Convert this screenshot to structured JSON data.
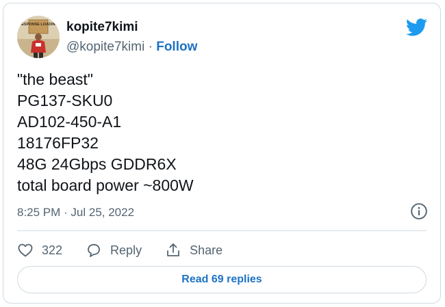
{
  "author": {
    "display_name": "kopite7kimi",
    "handle": "@kopite7kimi",
    "separator": "·",
    "follow_label": "Follow",
    "avatar_sign_text": "RESPONSE LOADING"
  },
  "tweet": {
    "lines": [
      "\"the beast\"",
      "PG137-SKU0",
      "AD102-450-A1",
      "18176FP32",
      "48G 24Gbps GDDR6X",
      "total board power ~800W"
    ],
    "timestamp": "8:25 PM · Jul 25, 2022"
  },
  "actions": {
    "like_count": "322",
    "reply_label": "Reply",
    "share_label": "Share"
  },
  "read_replies_label": "Read 69 replies",
  "icons": {
    "brand": "twitter-bird-icon",
    "info": "info-icon",
    "like": "heart-icon",
    "reply": "speech-bubble-icon",
    "share": "share-icon"
  },
  "colors": {
    "brand_blue": "#1d9bf0",
    "link_blue": "#1d72c4",
    "text": "#0f1419",
    "secondary_text": "#536471",
    "border": "#cfd9de"
  }
}
